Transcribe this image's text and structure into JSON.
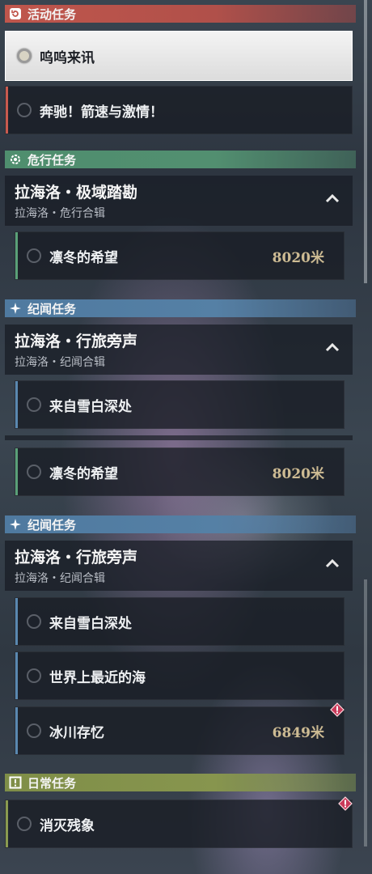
{
  "colors": {
    "activity": "#c85a4f",
    "danger": "#5aa078",
    "chronicle": "#5a88b0",
    "daily": "#8a9a50",
    "distance": "#cdbb93"
  },
  "activity": {
    "header": "活动任务",
    "quests": [
      "呜呜来讯",
      "奔驰！箭速与激情！"
    ]
  },
  "danger": {
    "header": "危行任务",
    "group_title": "拉海洛・极域踏勘",
    "group_sub": "拉海洛・危行合辑",
    "quest_name": "凛冬的希望",
    "quest_distance": "8020米"
  },
  "chronicle1": {
    "header": "纪闻任务",
    "group_title": "拉海洛・行旅旁声",
    "group_sub": "拉海洛・纪闻合辑",
    "quest_name": "来自雪白深处"
  },
  "repeat_quest": {
    "name": "凛冬的希望",
    "distance": "8020米"
  },
  "chronicle2": {
    "header": "纪闻任务",
    "group_title": "拉海洛・行旅旁声",
    "group_sub": "拉海洛・纪闻合辑",
    "quests": [
      "来自雪白深处",
      "世界上最近的海",
      "冰川存忆"
    ],
    "last_distance": "6849米"
  },
  "daily": {
    "header": "日常任务",
    "quest_name": "消灭残象"
  }
}
